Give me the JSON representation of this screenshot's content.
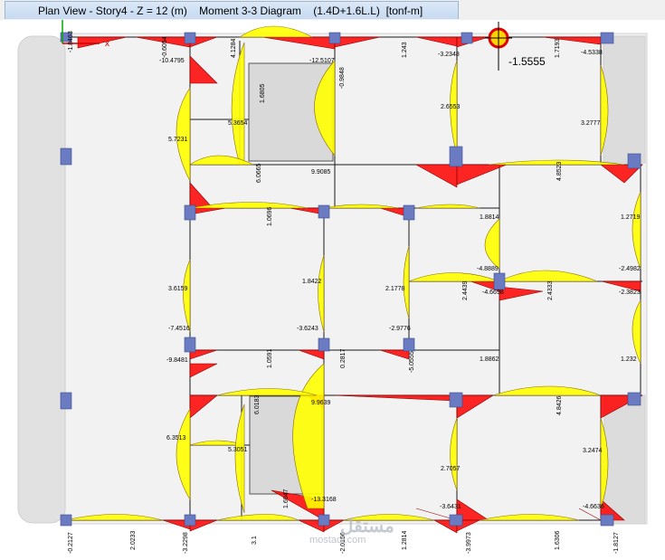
{
  "window": {
    "title": "Plan View - Story4 - Z = 12 (m)    Moment 3-3 Diagram    (1.4D+1.6L.L)  [tonf-m]"
  },
  "colors": {
    "slab_background": "#f2f2f2",
    "opening_fill": "#d9d9d9",
    "wall_fill": "#e1e1e1",
    "beam_line": "#000000",
    "negative_moment_fill": "#ff0000",
    "positive_moment_fill": "#ffff00",
    "column_fill": "#6a7bc2",
    "selection_marker": "#e00000"
  },
  "axis_label": "x",
  "selected_value": "-1.5555",
  "moment_labels": [
    {
      "text": "-1.8463",
      "rotated": true
    },
    {
      "text": "-10.4795",
      "rotated": false
    },
    {
      "text": "-0.6054",
      "rotated": true
    },
    {
      "text": "4.1284",
      "rotated": true
    },
    {
      "text": "-12.5107",
      "rotated": false
    },
    {
      "text": "1.6805",
      "rotated": true
    },
    {
      "text": "-0.9848",
      "rotated": true
    },
    {
      "text": "1.243",
      "rotated": true
    },
    {
      "text": "-3.2348",
      "rotated": false
    },
    {
      "text": "1.7193",
      "rotated": true
    },
    {
      "text": "-4.5338",
      "rotated": false
    },
    {
      "text": "5.3654",
      "rotated": false
    },
    {
      "text": "5.7231",
      "rotated": false
    },
    {
      "text": "2.6553",
      "rotated": false
    },
    {
      "text": "3.2777",
      "rotated": false
    },
    {
      "text": "6.0665",
      "rotated": true
    },
    {
      "text": "9.9085",
      "rotated": false
    },
    {
      "text": "4.8523",
      "rotated": true
    },
    {
      "text": "1.0696",
      "rotated": true
    },
    {
      "text": "1.8814",
      "rotated": false
    },
    {
      "text": "1.2719",
      "rotated": false
    },
    {
      "text": "-4.8889",
      "rotated": false
    },
    {
      "text": "-2.4982",
      "rotated": false
    },
    {
      "text": "3.6159",
      "rotated": false
    },
    {
      "text": "1.8422",
      "rotated": false
    },
    {
      "text": "2.1778",
      "rotated": false
    },
    {
      "text": "2.4439",
      "rotated": true
    },
    {
      "text": "-4.6698",
      "rotated": false
    },
    {
      "text": "2.4333",
      "rotated": true
    },
    {
      "text": "-2.3823",
      "rotated": false
    },
    {
      "text": "-7.4516",
      "rotated": false
    },
    {
      "text": "-3.6243",
      "rotated": false
    },
    {
      "text": "-2.9776",
      "rotated": false
    },
    {
      "text": "-9.8481",
      "rotated": false
    },
    {
      "text": "1.0591",
      "rotated": true
    },
    {
      "text": "0.2817",
      "rotated": true
    },
    {
      "text": "-5.0555",
      "rotated": true
    },
    {
      "text": "1.8862",
      "rotated": false
    },
    {
      "text": "1.232",
      "rotated": false
    },
    {
      "text": "6.0183",
      "rotated": true
    },
    {
      "text": "9.9639",
      "rotated": false
    },
    {
      "text": "4.8426",
      "rotated": true
    },
    {
      "text": "6.3513",
      "rotated": false
    },
    {
      "text": "5.3051",
      "rotated": false
    },
    {
      "text": "3.2474",
      "rotated": false
    },
    {
      "text": "2.7057",
      "rotated": false
    },
    {
      "text": "1.6047",
      "rotated": true
    },
    {
      "text": "-13.3168",
      "rotated": false
    },
    {
      "text": "-3.6431",
      "rotated": false
    },
    {
      "text": "-4.6636",
      "rotated": false
    },
    {
      "text": "-0.2127",
      "rotated": true
    },
    {
      "text": "2.0233",
      "rotated": true
    },
    {
      "text": "-3.2298",
      "rotated": true
    },
    {
      "text": "3.1",
      "rotated": true
    },
    {
      "text": "-2.0156",
      "rotated": true
    },
    {
      "text": "1.2814",
      "rotated": true
    },
    {
      "text": "-3.9973",
      "rotated": true
    },
    {
      "text": "1.6306",
      "rotated": true
    },
    {
      "text": "-1.8127",
      "rotated": true
    }
  ],
  "watermark": {
    "line1": "مستقل",
    "line2": "mostaql.com"
  }
}
